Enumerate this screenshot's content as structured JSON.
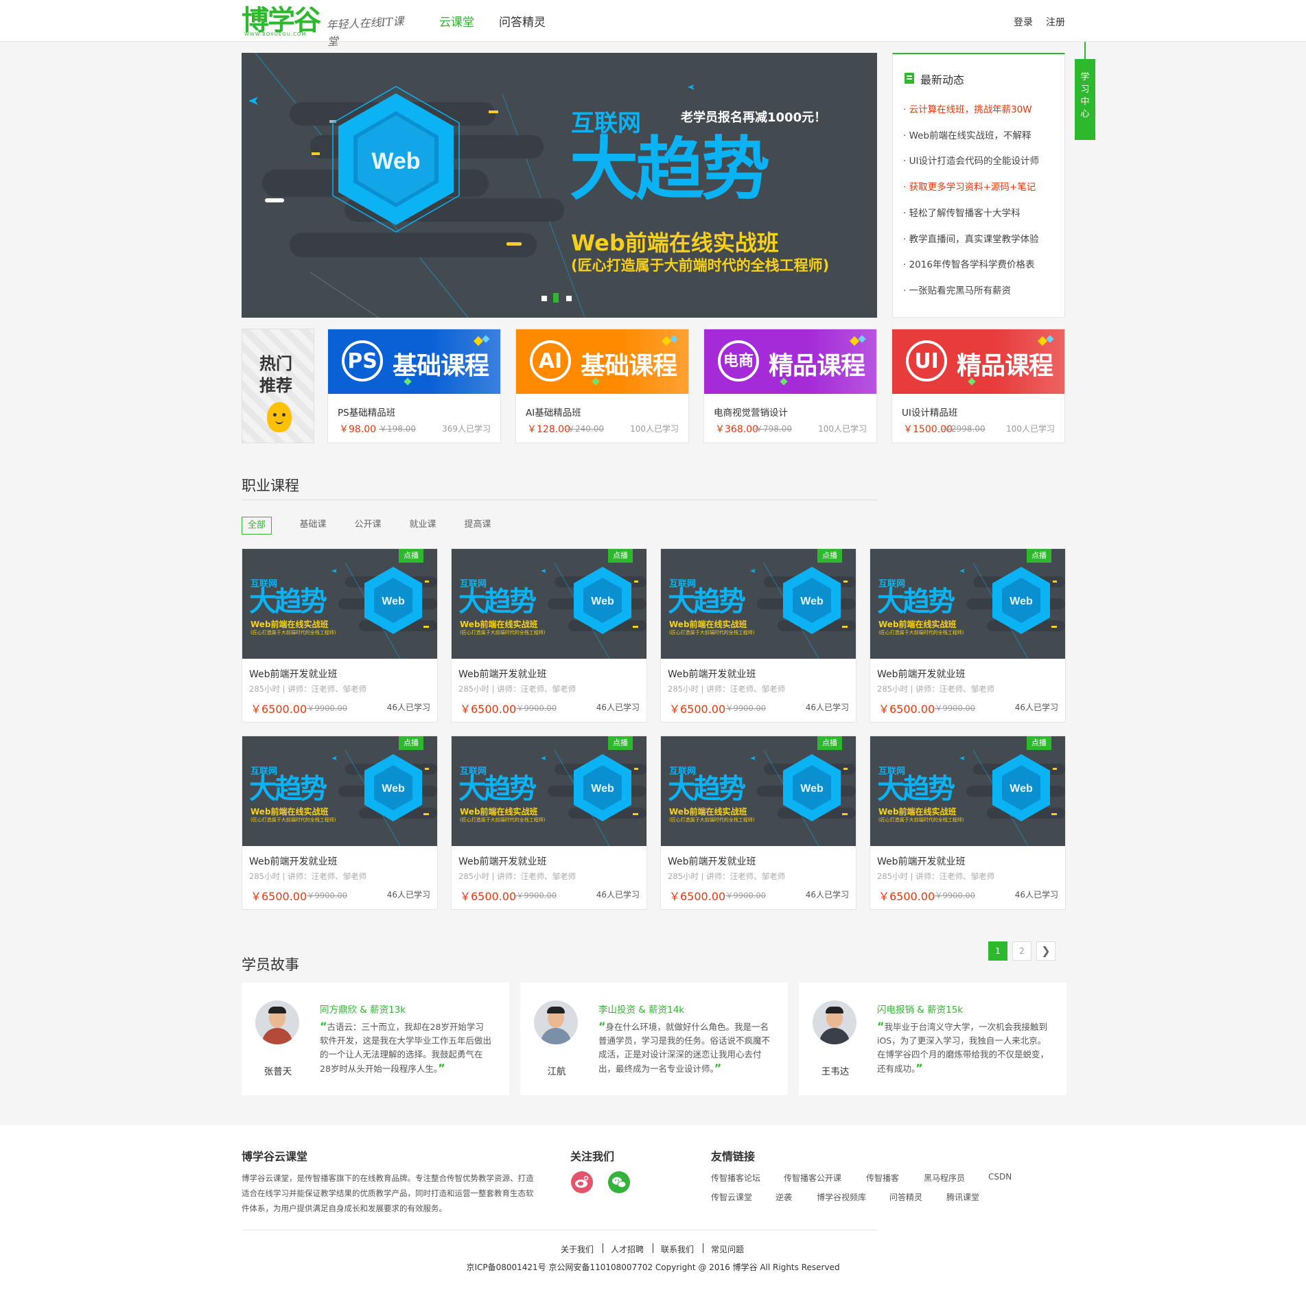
{
  "header": {
    "logo_text": "博学谷",
    "logo_url_text": "WWW.BOXUEGU.COM",
    "slogan": "年轻人在线IT课堂",
    "nav": [
      "云课堂",
      "问答精灵"
    ],
    "login": "登录",
    "register": "注册"
  },
  "side_tab": {
    "label": "学习中心"
  },
  "banner": {
    "top_left": "互联网",
    "top_right": "老学员报名再减1000元！",
    "headline": "大趋势",
    "subtitle": "Web前端在线实战班",
    "subtitle2": "(匠心打造属于大前端时代的全栈工程师)",
    "hex_label": "Web",
    "slides": 3,
    "active_slide": 2
  },
  "news": {
    "title": "最新动态",
    "items": [
      {
        "text": "· 云计算在线班，挑战年薪30W",
        "highlight": true
      },
      {
        "text": "· Web前端在线实战班，不解释",
        "highlight": false
      },
      {
        "text": "· UI设计打造会代码的全能设计师",
        "highlight": false
      },
      {
        "text": "· 获取更多学习资料+源码+笔记",
        "highlight": true
      },
      {
        "text": "· 轻松了解传智播客十大学科",
        "highlight": false
      },
      {
        "text": "· 教学直播间，真实课堂教学体验",
        "highlight": false
      },
      {
        "text": "· 2016年传智各学科学费价格表",
        "highlight": false
      },
      {
        "text": "· 一张贴看完黑马所有薪资",
        "highlight": false
      }
    ]
  },
  "hot": {
    "label1": "热门",
    "label2": "推荐",
    "cards": [
      {
        "badge": "PS",
        "label": "基础课程",
        "name": "PS基础精品班",
        "price": "￥98.00",
        "old": "￥198.00",
        "count": "369人已学习",
        "color": "#0a61d6"
      },
      {
        "badge": "AI",
        "label": "基础课程",
        "name": "AI基础精品班",
        "price": "￥128.00",
        "old": "￥240.00",
        "count": "100人已学习",
        "color": "#ff8a00"
      },
      {
        "badge": "电商",
        "label": "精品课程",
        "name": "电商视觉营销设计",
        "price": "￥368.00",
        "old": "￥798.00",
        "count": "100人已学习",
        "color": "#a52ad8"
      },
      {
        "badge": "UI",
        "label": "精品课程",
        "name": "UI设计精品班",
        "price": "￥1500.00",
        "old": "￥2998.00",
        "count": "100人已学习",
        "color": "#e83c3c"
      }
    ]
  },
  "career": {
    "title": "职业课程",
    "tabs": [
      "全部",
      "基础课",
      "公开课",
      "就业课",
      "提高课"
    ],
    "active_tab": 0,
    "card_badge": "点播",
    "card_img": {
      "t1": "互联网",
      "t2": "大趋势",
      "t3": "Web前端在线实战班",
      "t4": "(匠心打造属于大前端时代的全栈工程师)",
      "hex": "Web"
    },
    "courses": [
      {
        "title": "Web前端开发就业班",
        "meta": "285小时  |  讲师：汪老师、邹老师",
        "price": "￥6500.00",
        "old": "￥9900.00",
        "count": "46人已学习"
      },
      {
        "title": "Web前端开发就业班",
        "meta": "285小时  |  讲师：汪老师、邹老师",
        "price": "￥6500.00",
        "old": "￥9900.00",
        "count": "46人已学习"
      },
      {
        "title": "Web前端开发就业班",
        "meta": "285小时  |  讲师：汪老师、邹老师",
        "price": "￥6500.00",
        "old": "￥9900.00",
        "count": "46人已学习"
      },
      {
        "title": "Web前端开发就业班",
        "meta": "285小时  |  讲师：汪老师、邹老师",
        "price": "￥6500.00",
        "old": "￥9900.00",
        "count": "46人已学习"
      },
      {
        "title": "Web前端开发就业班",
        "meta": "285小时  |  讲师：汪老师、邹老师",
        "price": "￥6500.00",
        "old": "￥9900.00",
        "count": "46人已学习"
      },
      {
        "title": "Web前端开发就业班",
        "meta": "285小时  |  讲师：汪老师、邹老师",
        "price": "￥6500.00",
        "old": "￥9900.00",
        "count": "46人已学习"
      },
      {
        "title": "Web前端开发就业班",
        "meta": "285小时  |  讲师：汪老师、邹老师",
        "price": "￥6500.00",
        "old": "￥9900.00",
        "count": "46人已学习"
      },
      {
        "title": "Web前端开发就业班",
        "meta": "285小时  |  讲师：汪老师、邹老师",
        "price": "￥6500.00",
        "old": "￥9900.00",
        "count": "46人已学习"
      }
    ]
  },
  "stories": {
    "title": "学员故事",
    "pages": [
      "1",
      "2"
    ],
    "active_page": 0,
    "items": [
      {
        "name": "张普天",
        "headline": "同方鼎欣 & 薪资13k",
        "quote": "古语云：三十而立，我却在28岁开始学习软件开发，这是我在大学毕业工作五年后做出的一个让人无法理解的选择。我鼓起勇气在28岁时从头开始一段程序人生。",
        "avatar_color": "#b44a3a"
      },
      {
        "name": "江航",
        "headline": "李山投资 & 薪资14k",
        "quote": "身在什么环境，就做好什么角色。我是一名普通学员，学习是我的任务。俗话说不疯魔不成活，正是对设计深深的迷恋让我用心去付出，最终成为一名专业设计师。",
        "avatar_color": "#7a8fa8"
      },
      {
        "name": "王韦达",
        "headline": "闪电报销 & 薪资15k",
        "quote": "我毕业于台湾义守大学，一次机会我接触到iOS，为了更深入学习，我独自一人来北京。在博学谷四个月的磨炼带给我的不仅是蜕变，还有成功。",
        "avatar_color": "#3a3f4a"
      }
    ]
  },
  "footer": {
    "about_title": "博学谷云课堂",
    "about_text": "博学谷云课堂，是传智播客旗下的在线教育品牌。专注整合传智优势教学资源、打造适合在线学习并能保证教学结果的优质教学产品，同时打造和运营一整套教育生态软件体系，为用户提供满足自身成长和发展要求的有效服务。",
    "follow_title": "关注我们",
    "links_title": "友情链接",
    "links_row1": [
      "传智播客论坛",
      "传智播客公开课",
      "传智播客",
      "黑马程序员",
      "CSDN"
    ],
    "links_row2": [
      "传智云课堂",
      "逆袭",
      "博学谷视频库",
      "问答精灵",
      "腾讯课堂"
    ],
    "bottom_links": [
      "关于我们",
      "人才招聘",
      "联系我们",
      "常见问题"
    ],
    "copyright": "京ICP备08001421号 京公网安备110108007702 Copyright @ 2016 博学谷 All Rights Reserved"
  },
  "colors": {
    "brand": "#2eb82e",
    "price": "#e8380d",
    "banner_bg": "#434a50",
    "banner_blue": "#0bb3f5",
    "banner_yellow": "#f7d01b"
  }
}
